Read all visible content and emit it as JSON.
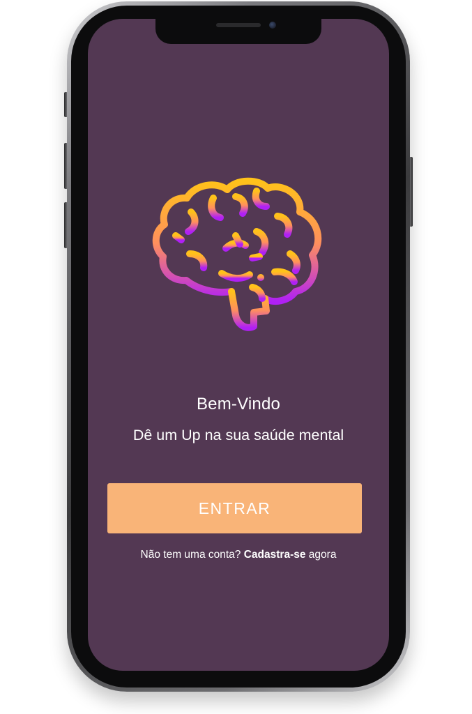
{
  "welcome": {
    "title": "Bem-Vindo",
    "subtitle": "Dê um Up na sua saúde mental"
  },
  "actions": {
    "login_label": "ENTRAR"
  },
  "signup": {
    "prefix": "Não tem uma conta?",
    "link_label": "Cadastra-se",
    "suffix": "agora"
  },
  "logo": {
    "icon": "brain-icon",
    "gradient": [
      "#ffc21a",
      "#ff8f5e",
      "#b020f5"
    ]
  },
  "colors": {
    "background": "#533853",
    "button": "#f9b478",
    "text": "#ffffff"
  }
}
